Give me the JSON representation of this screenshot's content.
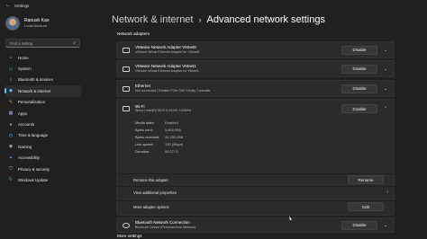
{
  "window": {
    "title": "Settings"
  },
  "profile": {
    "name": "Ranush Kao",
    "account": "Local Account"
  },
  "search": {
    "placeholder": "Find a setting"
  },
  "nav": [
    {
      "label": "Home",
      "icon": "home-icon",
      "color": "#f0c26b"
    },
    {
      "label": "System",
      "icon": "system-icon",
      "color": "#4cc2ff"
    },
    {
      "label": "Bluetooth & devices",
      "icon": "bluetooth-icon",
      "color": "#4cc2ff"
    },
    {
      "label": "Network & internet",
      "icon": "network-icon",
      "color": "#6cc5ff"
    },
    {
      "label": "Personalization",
      "icon": "brush-icon",
      "color": "#f1a15c"
    },
    {
      "label": "Apps",
      "icon": "apps-icon",
      "color": "#c4a1ff"
    },
    {
      "label": "Accounts",
      "icon": "accounts-icon",
      "color": "#5ed18a"
    },
    {
      "label": "Time & language",
      "icon": "time-icon",
      "color": "#4cc2ff"
    },
    {
      "label": "Gaming",
      "icon": "gaming-icon",
      "color": "#b6b6b6"
    },
    {
      "label": "Accessibility",
      "icon": "accessibility-icon",
      "color": "#58a6ff"
    },
    {
      "label": "Privacy & security",
      "icon": "shield-icon",
      "color": "#9aa6b2"
    },
    {
      "label": "Windows Update",
      "icon": "update-icon",
      "color": "#4cc2ff"
    }
  ],
  "header": {
    "parent": "Network & internet",
    "separator": "›",
    "current": "Advanced network settings"
  },
  "section": {
    "adapters_title": "Network adapters",
    "more_title": "More settings"
  },
  "adapters": [
    {
      "name": "VMware Network Adapter VMnet8",
      "desc": "VMware Virtual Ethernet Adapter for VMnet8",
      "button": "Disable"
    },
    {
      "name": "VMware Network Adapter VMnet1",
      "desc": "VMware Virtual Ethernet Adapter for VMnet1",
      "button": "Disable"
    },
    {
      "name": "Ethernet",
      "desc": "Not connected | Realtek PCIe GbE Family Controller",
      "button": "Disable"
    }
  ],
  "wifi": {
    "name": "Wi-Fi",
    "desc": "Sinna | Intel(R) Wi-Fi 6 AX201 160MHz",
    "button": "Disable",
    "details": [
      {
        "label": "Media state:",
        "value": "Enabled"
      },
      {
        "label": "Bytes sent:",
        "value": "5,805,555"
      },
      {
        "label": "Bytes received:",
        "value": "44,392,858"
      },
      {
        "label": "Link speed:",
        "value": "130 (Mbps)"
      },
      {
        "label": "Duration:",
        "value": "00:27:11"
      }
    ],
    "rename_label": "Rename this adapter",
    "rename_button": "Rename",
    "view_props_label": "View additional properties",
    "more_options_label": "More adapter options",
    "edit_button": "Edit"
  },
  "bluetooth": {
    "name": "Bluetooth Network Connection",
    "desc": "Bluetooth Device (Personal Area Network)",
    "button": "Disable"
  }
}
